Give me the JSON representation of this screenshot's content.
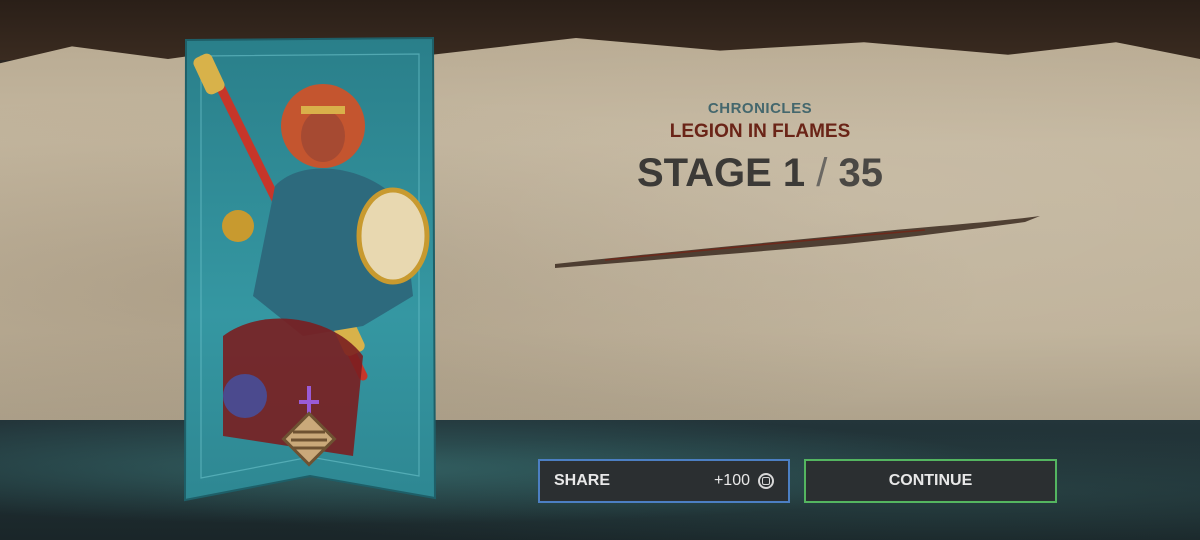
{
  "header": {
    "mode": "CHRONICLES",
    "chapter": "LEGION IN FLAMES",
    "stage_prefix": "STAGE",
    "stage_current": "1",
    "stage_separator": "/",
    "stage_total": "35"
  },
  "actions": {
    "share_label": "SHARE",
    "share_reward": "+100",
    "continue_label": "CONTINUE"
  },
  "colors": {
    "share_border": "#4c7fc3",
    "continue_border": "#54b560",
    "banner": "#2f8a96",
    "chapter_text": "#6a2417"
  },
  "icons": {
    "banner_top": "dagger-icon",
    "banner_emblem": "rank-emblem-icon",
    "reward_currency": "coin-icon"
  }
}
